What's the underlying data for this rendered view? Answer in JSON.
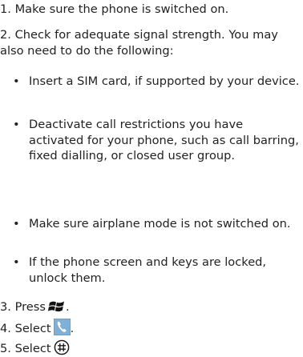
{
  "steps": {
    "step1": "1. Make sure the phone is switched on.",
    "step2": "2. Check for adequate signal strength. You may also need to do the following:",
    "step3": "3. Press",
    "step4": "4. Select",
    "step5": "5. Select",
    "period": "."
  },
  "bullets": [
    "Insert a SIM card, if supported by your device.",
    "Deactivate call restrictions you have activated for your phone, such as call barring, fixed dialling, or closed user group.",
    "Make sure airplane mode is not switched on.",
    "If the phone screen and keys are locked, unlock them."
  ],
  "bullet_symbol": "•",
  "icons": {
    "start": "windows-start-icon",
    "phone": "phone-tile-icon",
    "keypad": "keypad-icon"
  },
  "colors": {
    "text": "#222222",
    "phone_tile": "#7fb0d8"
  }
}
